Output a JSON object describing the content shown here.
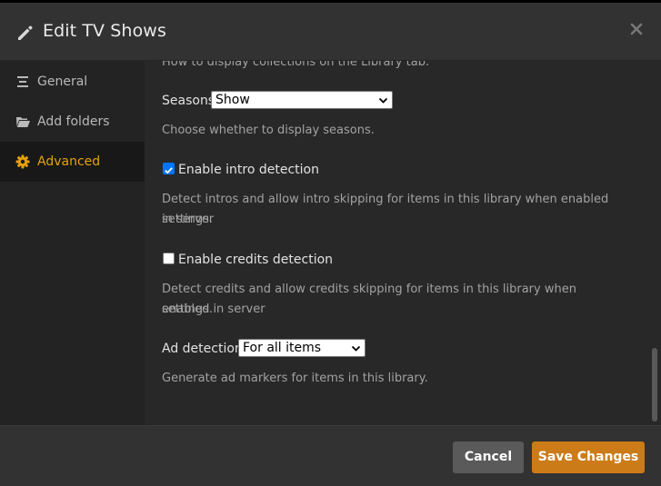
{
  "header": {
    "title": "Edit TV Shows",
    "close_icon": "close-icon"
  },
  "sidebar": {
    "items": [
      {
        "label": "General",
        "icon": "list-icon"
      },
      {
        "label": "Add folders",
        "icon": "folder-icon"
      },
      {
        "label": "Advanced",
        "icon": "gear-icon",
        "active": true
      }
    ]
  },
  "content": {
    "collections_help": "How to display collections on the Library tab.",
    "seasons": {
      "label": "Seasons",
      "value": "Show",
      "help": "Choose whether to display seasons."
    },
    "intro_detection": {
      "label": "Enable intro detection",
      "checked": true,
      "help_line1": "Detect intros and allow intro skipping for items in this library when enabled in server",
      "help_line2": "settings."
    },
    "credits_detection": {
      "label": "Enable credits detection",
      "checked": false,
      "help_line1": "Detect credits and allow credits skipping for items in this library when enabled in server",
      "help_line2": "settings."
    },
    "ad_detection": {
      "label": "Ad detection",
      "value": "For all items",
      "help": "Generate ad markers for items in this library."
    }
  },
  "footer": {
    "cancel_label": "Cancel",
    "save_label": "Save Changes"
  },
  "colors": {
    "accent": "#e5a00d",
    "save_button": "#cc7b19",
    "cancel_button": "#5a5a5a",
    "checkbox_checked": "#0075ff"
  }
}
